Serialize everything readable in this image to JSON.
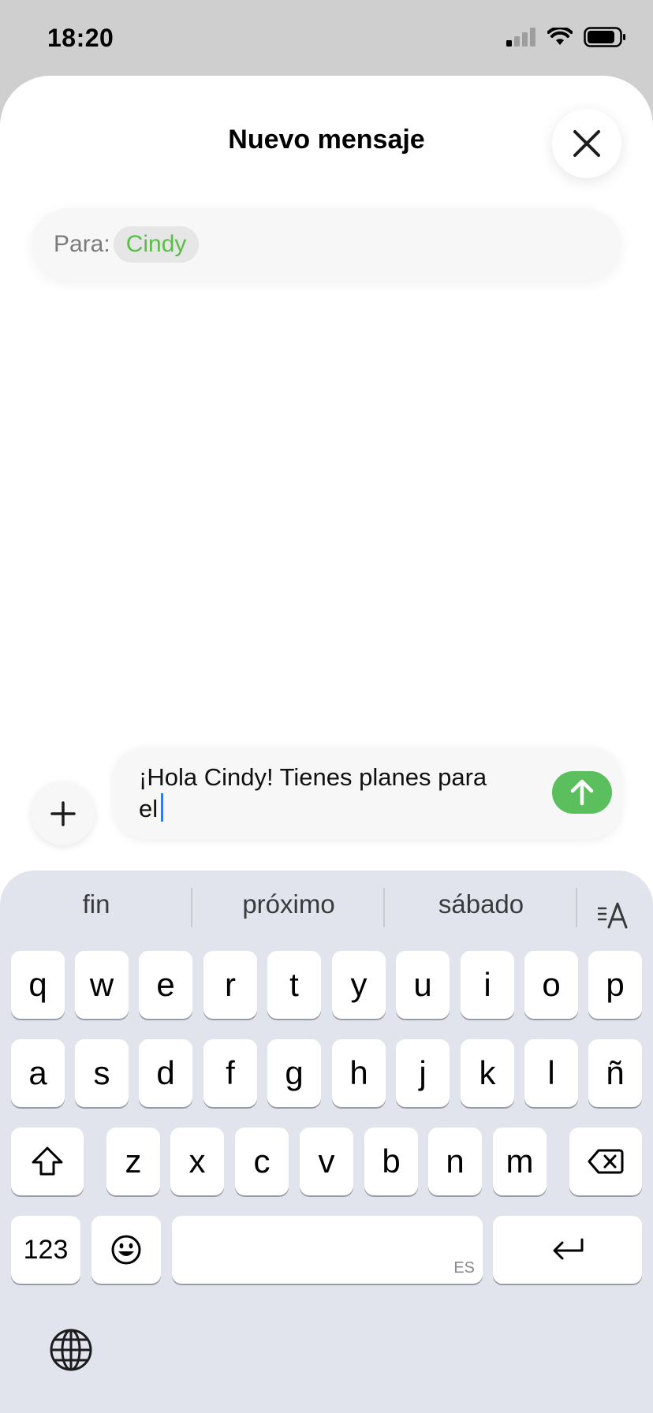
{
  "status_bar": {
    "time": "18:20"
  },
  "header": {
    "title": "Nuevo mensaje"
  },
  "to_field": {
    "label": "Para:",
    "recipient": "Cindy"
  },
  "composer": {
    "text_line1": "¡Hola Cindy! Tienes planes para",
    "text_line2": "el"
  },
  "keyboard": {
    "suggestions": [
      "fin",
      "próximo",
      "sábado"
    ],
    "row1": [
      "q",
      "w",
      "e",
      "r",
      "t",
      "y",
      "u",
      "i",
      "o",
      "p"
    ],
    "row2": [
      "a",
      "s",
      "d",
      "f",
      "g",
      "h",
      "j",
      "k",
      "l",
      "ñ"
    ],
    "row3": [
      "z",
      "x",
      "c",
      "v",
      "b",
      "n",
      "m"
    ],
    "numbers_label": "123",
    "space_lang": "ES"
  },
  "icons": [
    "signal-icon",
    "wifi-icon",
    "battery-icon",
    "close-icon",
    "plus-icon",
    "send-arrow-icon",
    "text-format-icon",
    "shift-icon",
    "backspace-icon",
    "emoji-icon",
    "return-icon",
    "globe-icon"
  ]
}
